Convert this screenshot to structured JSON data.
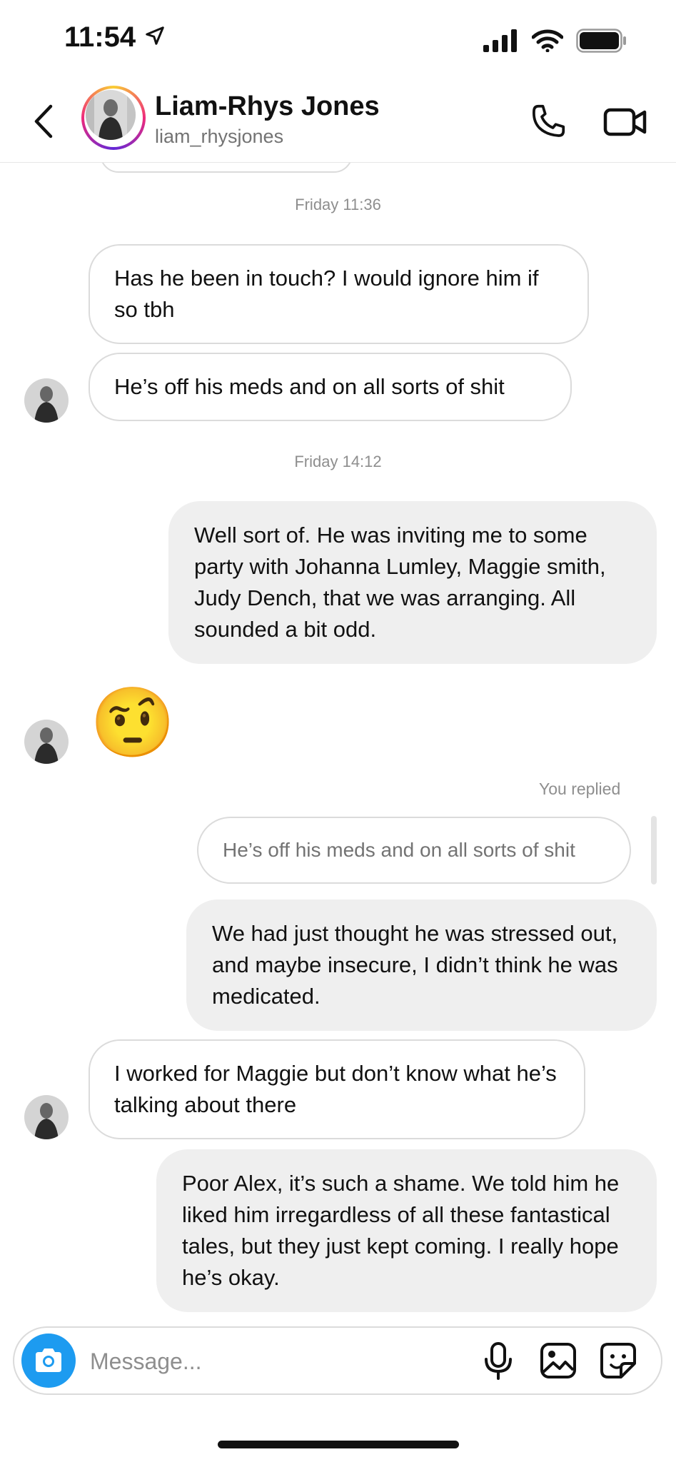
{
  "status_bar": {
    "time": "11:54"
  },
  "header": {
    "name": "Liam-Rhys Jones",
    "username": "liam_rhysjones"
  },
  "messages": {
    "ts1": "Friday 11:36",
    "m1": "Has he been in touch? I would ignore him if so tbh",
    "m2": "He’s off his meds and on all sorts of shit",
    "ts2": "Friday 14:12",
    "m3": "Well sort of. He was inviting me to some party with Johanna Lumley, Maggie smith, Judy Dench, that we was arranging. All sounded a bit odd.",
    "m4_emoji": "🤨",
    "replied_label": "You replied",
    "reply_quote": "He’s off his meds and on all sorts of shit",
    "m5": "We had just thought he was stressed out, and maybe insecure, I didn’t think he was medicated.",
    "m6": "I worked for Maggie but don’t know what he’s talking about there",
    "m7": "Poor Alex, it’s such a shame. We told him he liked him irregardless of all these fantastical tales, but they just kept coming. I really hope he’s okay."
  },
  "composer": {
    "placeholder": "Message..."
  },
  "colors": {
    "accent": "#1d9bf0",
    "outgoing_bubble": "#efefef",
    "bubble_border": "#dbdbdb",
    "muted_text": "#8e8e8e"
  },
  "icons": [
    "location-arrow-icon",
    "signal-icon",
    "wifi-icon",
    "battery-icon",
    "back-chevron-icon",
    "phone-icon",
    "video-camera-icon",
    "camera-icon",
    "microphone-icon",
    "gallery-icon",
    "sticker-icon"
  ]
}
